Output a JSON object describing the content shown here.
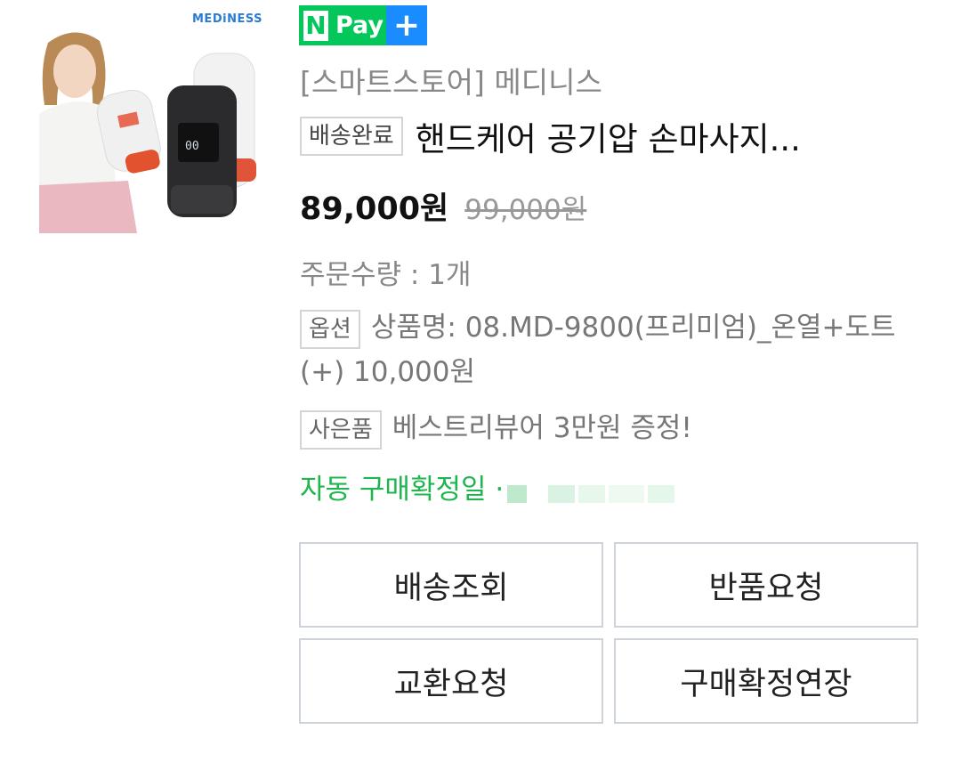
{
  "product": {
    "brand_logo": "MEDiNESS",
    "npay": {
      "n": "N",
      "pay": "Pay",
      "plus": "+"
    },
    "store": "[스마트스토어] 메디니스",
    "status_tag": "배송완료",
    "title": "핸드케어 공기압 손마사지...",
    "price_now": "89,000원",
    "price_was": "99,000원",
    "quantity": "주문수량 : 1개",
    "option_tag": "옵션",
    "option_text": "상품명: 08.MD-9800(프리미엄)_온열+도트 (+) 10,000원",
    "gift_tag": "사은품",
    "gift_text": "베스트리뷰어 3만원 증정!",
    "auto_confirm": "자동 구매확정일 ·"
  },
  "actions": {
    "track": "배송조회",
    "return": "반품요청",
    "exchange": "교환요청",
    "extend": "구매확정연장"
  },
  "colors": {
    "npay_green": "#03c75a",
    "npay_blue": "#1a8cff",
    "confirm_green": "#1fb54f"
  }
}
